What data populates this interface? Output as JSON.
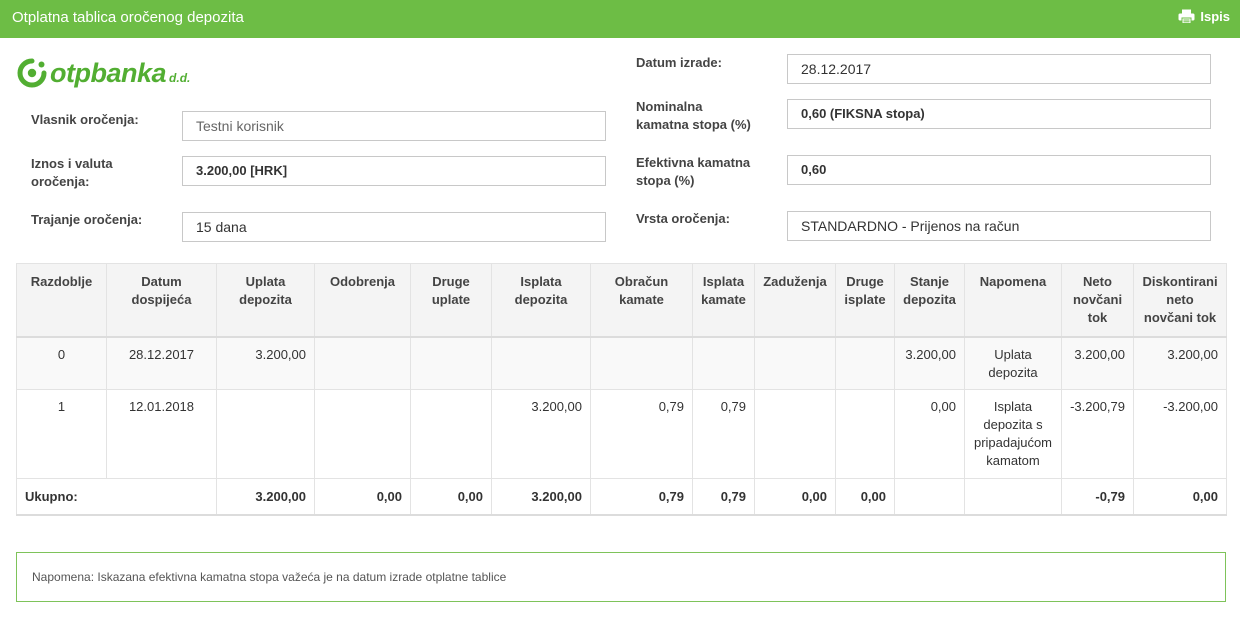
{
  "header": {
    "title": "Otplatna tablica oročenog depozita",
    "print_label": "Ispis",
    "print_icon": "printer-icon",
    "bar_color": "#6dbd45"
  },
  "logo": {
    "word_otp": "otp",
    "word_banka": "banka",
    "suffix": "d.d.",
    "brand_color": "#52ae32"
  },
  "form": {
    "owner_label": "Vlasnik oročenja:",
    "owner_value": "Testni korisnik",
    "amount_label_1": "Iznos i valuta",
    "amount_label_2": "oročenja:",
    "amount_value": "3.200,00 [HRK]",
    "duration_label": "Trajanje oročenja:",
    "duration_value": "15 dana",
    "date_label": "Datum izrade:",
    "date_value": "28.12.2017",
    "nominal_label_1": "Nominalna",
    "nominal_label_2": "kamatna stopa (%)",
    "nominal_value": "0,60  (FIKSNA stopa)",
    "effective_label_1": "Efektivna kamatna",
    "effective_label_2": "stopa (%)",
    "effective_value": "0,60",
    "type_label": "Vrsta oročenja:",
    "type_value": "STANDARDNO - Prijenos na račun"
  },
  "table": {
    "headers": [
      [
        "Razdoblje"
      ],
      [
        "Datum",
        "dospijeća"
      ],
      [
        "Uplata",
        "depozita"
      ],
      [
        "Odobrenja"
      ],
      [
        "Druge",
        "uplate"
      ],
      [
        "Isplata",
        "depozita"
      ],
      [
        "Obračun",
        "kamate"
      ],
      [
        "Isplata",
        "kamate"
      ],
      [
        "Zaduženja"
      ],
      [
        "Druge",
        "isplate"
      ],
      [
        "Stanje",
        "depozita"
      ],
      [
        "Napomena"
      ],
      [
        "Neto",
        "novčani",
        "tok"
      ],
      [
        "Diskontirani",
        "neto",
        "novčani tok"
      ]
    ],
    "rows": [
      {
        "cells": [
          "0",
          "28.12.2017",
          "3.200,00",
          "",
          "",
          "",
          "",
          "",
          "",
          "",
          "3.200,00",
          "",
          "3.200,00",
          "3.200,00"
        ],
        "note": [
          "Uplata",
          "depozita"
        ]
      },
      {
        "cells": [
          "1",
          "12.01.2018",
          "",
          "",
          "",
          "3.200,00",
          "0,79",
          "0,79",
          "",
          "",
          "0,00",
          "",
          "-3.200,79",
          "-3.200,00"
        ],
        "note": [
          "Isplata",
          "depozita s",
          "pripadajućom",
          "kamatom"
        ]
      }
    ],
    "total": {
      "label": "Ukupno:",
      "cells": [
        "3.200,00",
        "0,00",
        "0,00",
        "3.200,00",
        "0,79",
        "0,79",
        "0,00",
        "0,00",
        "",
        "",
        "-0,79",
        "0,00"
      ]
    }
  },
  "footnote": "Napomena: Iskazana efektivna kamatna stopa važeća je na datum izrade otplatne tablice"
}
